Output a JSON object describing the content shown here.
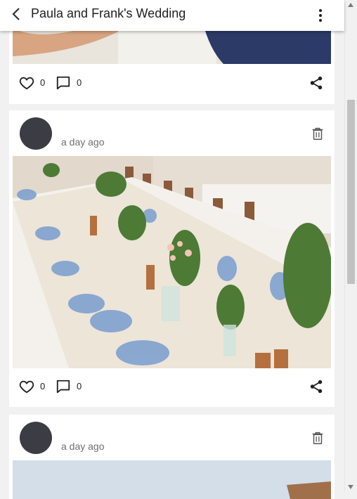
{
  "header": {
    "title": "Paula and Frank's Wedding",
    "back_icon": "chevron-left-icon",
    "menu_icon": "more-vertical-icon"
  },
  "posts": [
    {
      "likes": "0",
      "comments": "0",
      "icons": [
        "heart-outline-icon",
        "comment-icon",
        "share-icon"
      ]
    },
    {
      "time": "a day ago",
      "likes": "0",
      "comments": "0",
      "icons": [
        "trash-icon",
        "heart-outline-icon",
        "comment-icon",
        "share-icon"
      ]
    },
    {
      "time": "a day ago",
      "icons": [
        "trash-icon"
      ]
    }
  ],
  "colors": {
    "background": "#f1f1f1",
    "card": "#ffffff",
    "avatar": "#3b3c44",
    "muted_text": "#6f6f6f",
    "icon": "#212121"
  }
}
